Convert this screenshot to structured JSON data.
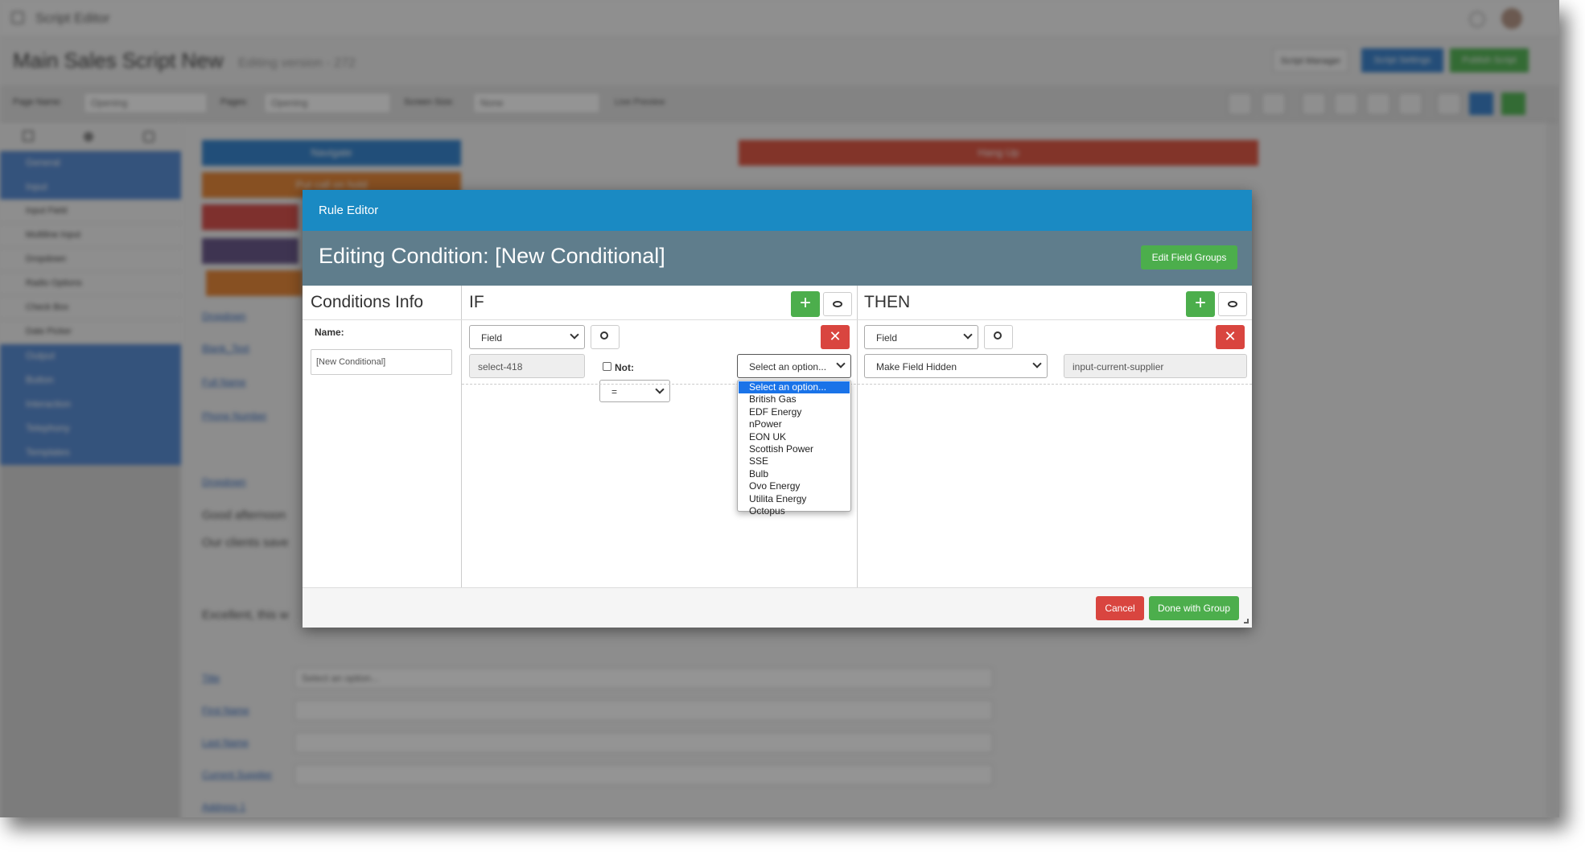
{
  "app": {
    "title": "Script Editor"
  },
  "header": {
    "script_name": "Main Sales Script New",
    "version_text": "Editing version - 272",
    "buttons": [
      "Script Manager",
      "Script Settings",
      "Publish Script"
    ]
  },
  "toolbar": {
    "page_name_label": "Page Name:",
    "page_name_value": "Opening",
    "pages_label": "Pages:",
    "pages_value": "Opening",
    "screen_size_label": "Screen Size:",
    "screen_size_value": "None",
    "live_preview_label": "Live Preview"
  },
  "sidebar": {
    "items": [
      {
        "label": "General",
        "type": "category"
      },
      {
        "label": "Input",
        "type": "category"
      },
      {
        "label": "Input Field",
        "type": "item"
      },
      {
        "label": "Multiline Input",
        "type": "item"
      },
      {
        "label": "Dropdown",
        "type": "item"
      },
      {
        "label": "Radio Options",
        "type": "item"
      },
      {
        "label": "Check Box",
        "type": "item"
      },
      {
        "label": "Date Picker",
        "type": "item"
      },
      {
        "label": "Output",
        "type": "category"
      },
      {
        "label": "Button",
        "type": "category"
      },
      {
        "label": "Interaction",
        "type": "category"
      },
      {
        "label": "Telephony",
        "type": "category"
      },
      {
        "label": "Templates",
        "type": "category"
      }
    ]
  },
  "canvas": {
    "buttons": [
      {
        "label": "Navigate",
        "color": "#3a87d0"
      },
      {
        "label": "Hang Up",
        "color": "#e05a47"
      },
      {
        "label": "Put call on hold",
        "color": "#e88a3c"
      }
    ],
    "field_labels": [
      "Dropdown",
      "Blank_Text",
      "Full Name",
      "Phone Number",
      "Dropdown",
      "Title",
      "First Name",
      "Last Name",
      "Current Supplier",
      "Address 1"
    ],
    "text_lines": [
      "Good afternoon",
      "Our clients save",
      "Excellent, this w"
    ],
    "title_select_placeholder": "Select an option..."
  },
  "modal": {
    "header": "Rule Editor",
    "subtitle": "Editing Condition: [New Conditional]",
    "edit_groups_button": "Edit Field Groups",
    "conditions_info": {
      "title": "Conditions Info",
      "name_label": "Name:",
      "name_value": "[New Conditional]"
    },
    "if_section": {
      "title": "IF",
      "type_select": "Field",
      "field_value": "select-418",
      "not_label": "Not:",
      "operator": "=",
      "value_select": "Select an option...",
      "options": [
        "Select an option...",
        "British Gas",
        "EDF Energy",
        "nPower",
        "EON UK",
        "Scottish Power",
        "SSE",
        "Bulb",
        "Ovo Energy",
        "Utilita Energy",
        "Octopus"
      ]
    },
    "then_section": {
      "title": "THEN",
      "type_select": "Field",
      "action_select": "Make Field Hidden",
      "target_value": "input-current-supplier"
    },
    "footer": {
      "cancel": "Cancel",
      "done": "Done with Group"
    }
  },
  "colors": {
    "modal_header": "#1a8ac3",
    "modal_subtitle": "#5f7d8c",
    "green": "#4cae4c",
    "red": "#d9453f",
    "selected_option": "#1a73e8"
  }
}
